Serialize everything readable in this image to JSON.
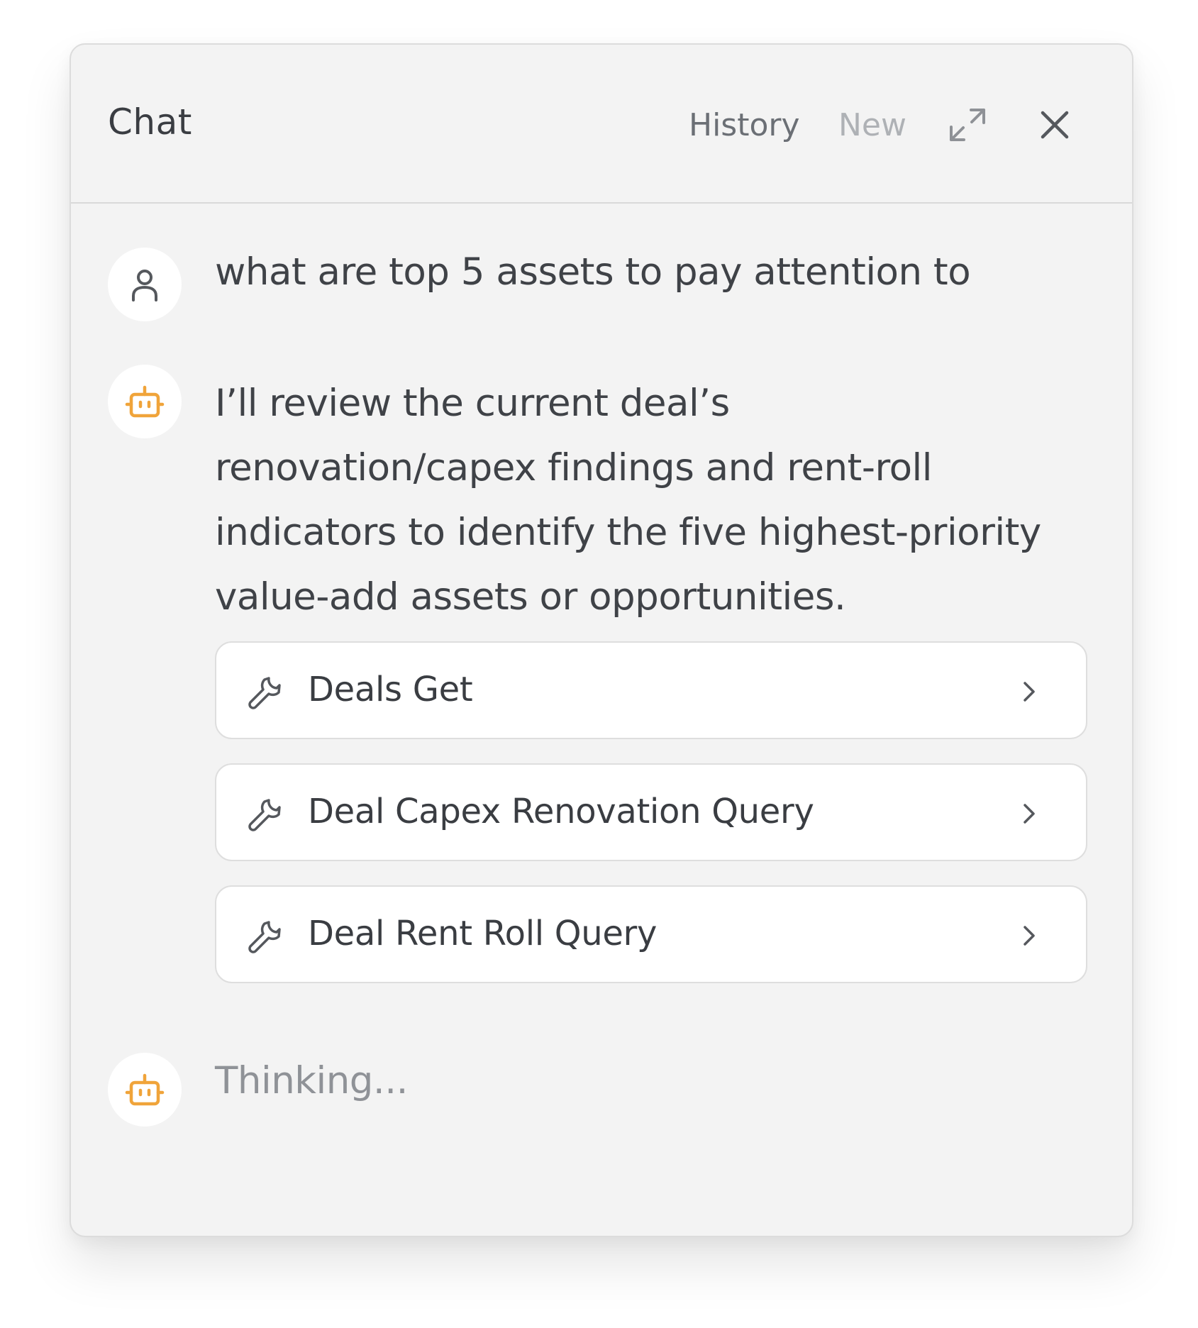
{
  "header": {
    "title": "Chat",
    "history_label": "History",
    "new_label": "New"
  },
  "icons": {
    "expand": "expand-icon",
    "close": "close-icon",
    "user_avatar": "user-icon",
    "bot_avatar": "bot-icon",
    "tool": "wrench-icon",
    "chevron": "chevron-right-icon"
  },
  "colors": {
    "panel_bg": "#f3f3f3",
    "bot_accent": "#f0a43a",
    "text": "#3f4247",
    "muted": "#8f9297"
  },
  "messages": {
    "user_text": "what are top 5 assets to pay attention to",
    "assistant_text": "I’ll review the current deal’s renovation/capex findings and rent-roll indicators to identify the five highest-priority value-add assets or opportunities.",
    "tools": [
      {
        "label": "Deals Get"
      },
      {
        "label": "Deal Capex Renovation Query"
      },
      {
        "label": "Deal Rent Roll Query"
      }
    ],
    "thinking_text": "Thinking..."
  }
}
